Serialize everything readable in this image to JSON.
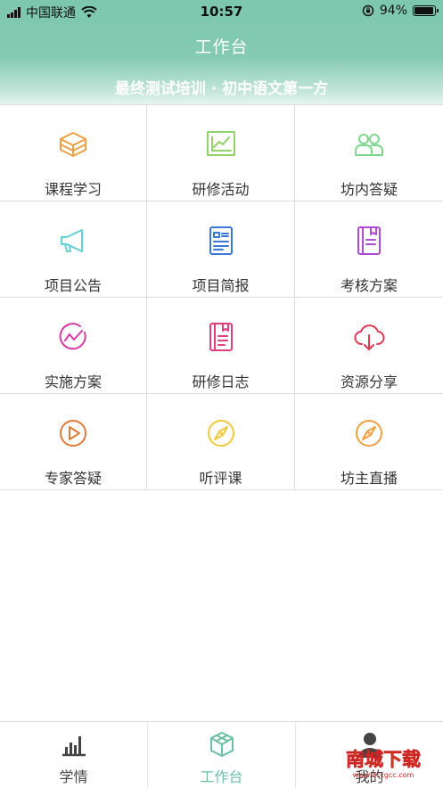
{
  "status": {
    "carrier": "中国联通",
    "time": "10:57",
    "battery": "94%",
    "battery_level": 0.94
  },
  "header": {
    "title": "工作台",
    "subtitle": "最终测试培训 · 初中语文第一方"
  },
  "menu": [
    {
      "label": "课程学习",
      "icon": "layers-box-icon",
      "color": "#f0a042"
    },
    {
      "label": "研修活动",
      "icon": "chart-board-icon",
      "color": "#8fd36a"
    },
    {
      "label": "坊内答疑",
      "icon": "users-icon",
      "color": "#7ed68f"
    },
    {
      "label": "项目公告",
      "icon": "megaphone-icon",
      "color": "#5fd2d6"
    },
    {
      "label": "项目简报",
      "icon": "report-icon",
      "color": "#3a78d8"
    },
    {
      "label": "考核方案",
      "icon": "notebook-icon",
      "color": "#b04ad6"
    },
    {
      "label": "实施方案",
      "icon": "trend-circle-icon",
      "color": "#d83aa8"
    },
    {
      "label": "研修日志",
      "icon": "journal-icon",
      "color": "#e0407a"
    },
    {
      "label": "资源分享",
      "icon": "cloud-download-icon",
      "color": "#e03a55"
    },
    {
      "label": "专家答疑",
      "icon": "play-circle-icon",
      "color": "#e07a3a"
    },
    {
      "label": "听评课",
      "icon": "compass-icon",
      "color": "#f0c93a"
    },
    {
      "label": "坊主直播",
      "icon": "compass-icon",
      "color": "#f0a042"
    }
  ],
  "tabs": [
    {
      "label": "学情",
      "icon": "bar-chart-icon"
    },
    {
      "label": "工作台",
      "icon": "cube-icon",
      "active": true
    },
    {
      "label": "我的",
      "icon": "person-icon"
    }
  ],
  "watermark": {
    "brand": "南城下载",
    "url": "www.nccgcc.com"
  }
}
